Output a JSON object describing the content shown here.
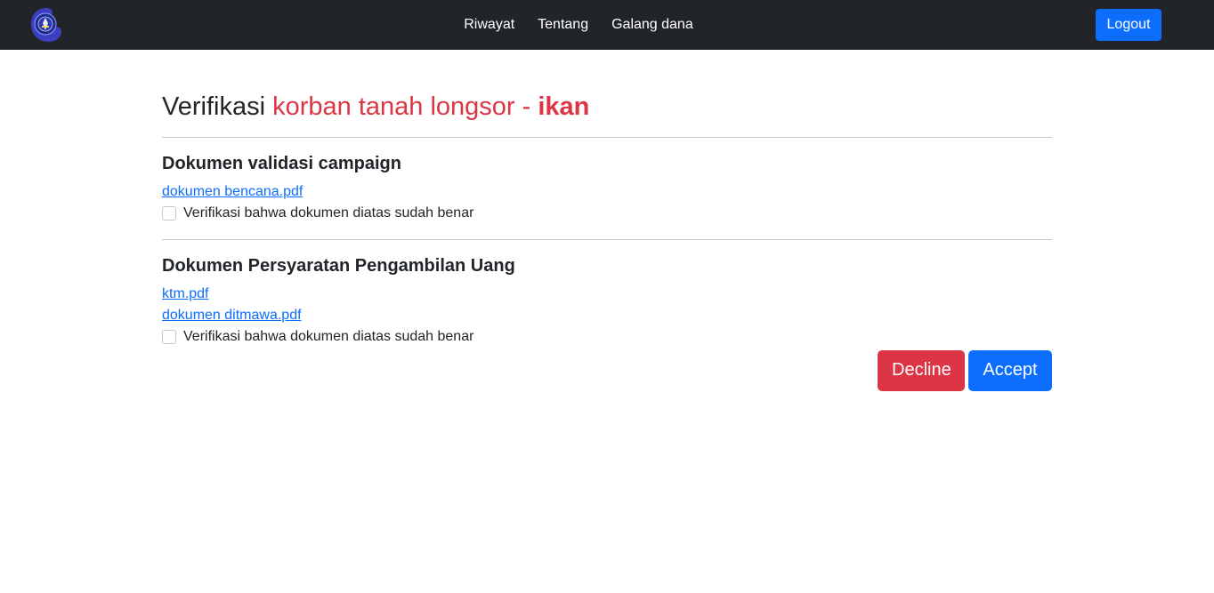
{
  "navbar": {
    "logo_icon": "university-seal-icon",
    "links": [
      "Riwayat",
      "Tentang",
      "Galang dana"
    ],
    "logout_label": "Logout",
    "background": "#212529",
    "accent": "#0d6efd"
  },
  "page": {
    "title_prefix": "Verifikasi",
    "title_campaign": "korban tanah longsor -",
    "title_user": "ikan",
    "title_color": "#dc3545"
  },
  "sections": [
    {
      "title": "Dokumen validasi campaign",
      "documents": [
        "dokumen bencana.pdf"
      ],
      "checkbox_label": "Verifikasi bahwa dokumen diatas sudah benar",
      "checked": false
    },
    {
      "title": "Dokumen Persyaratan Pengambilan Uang",
      "documents": [
        "ktm.pdf",
        "dokumen ditmawa.pdf"
      ],
      "checkbox_label": "Verifikasi bahwa dokumen diatas sudah benar",
      "checked": false
    }
  ],
  "actions": {
    "decline_label": "Decline",
    "accept_label": "Accept",
    "decline_color": "#dc3545",
    "accept_color": "#0d6efd"
  }
}
